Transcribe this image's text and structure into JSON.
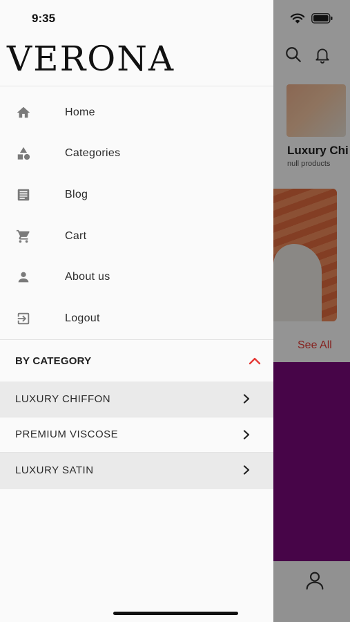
{
  "status_bar": {
    "time": "9:35"
  },
  "drawer": {
    "brand": "VERONA",
    "nav_items": [
      {
        "label": "Home",
        "icon": "home-icon"
      },
      {
        "label": "Categories",
        "icon": "categories-icon"
      },
      {
        "label": "Blog",
        "icon": "blog-icon"
      },
      {
        "label": "Cart",
        "icon": "cart-icon"
      },
      {
        "label": "About us",
        "icon": "person-icon"
      },
      {
        "label": "Logout",
        "icon": "logout-icon"
      }
    ],
    "category_section": {
      "title": "BY CATEGORY",
      "expanded_icon": "chevron-up-icon",
      "items": [
        {
          "label": "LUXURY CHIFFON"
        },
        {
          "label": "PREMIUM VISCOSE"
        },
        {
          "label": "LUXURY SATIN"
        }
      ]
    }
  },
  "background_screen": {
    "product_card": {
      "title": "Luxury Chi",
      "subtitle": "null products"
    },
    "see_all": "See All"
  },
  "colors": {
    "accent": "#e53935",
    "drawer_bg": "#fafafa",
    "category_row_shaded": "#eaeaea",
    "banner": "#7a0a7c"
  }
}
